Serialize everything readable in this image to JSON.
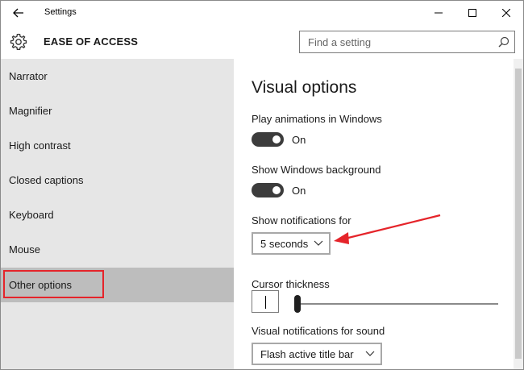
{
  "window": {
    "title": "Settings"
  },
  "header": {
    "app_title": "EASE OF ACCESS",
    "search_placeholder": "Find a setting"
  },
  "nav": {
    "items": [
      {
        "label": "Narrator"
      },
      {
        "label": "Magnifier"
      },
      {
        "label": "High contrast"
      },
      {
        "label": "Closed captions"
      },
      {
        "label": "Keyboard"
      },
      {
        "label": "Mouse"
      },
      {
        "label": "Other options"
      }
    ],
    "selected_index": 6
  },
  "content": {
    "section_title": "Visual options",
    "play_animations": {
      "label": "Play animations in Windows",
      "state": "On"
    },
    "show_background": {
      "label": "Show Windows background",
      "state": "On"
    },
    "notifications": {
      "label": "Show notifications for",
      "value": "5 seconds"
    },
    "cursor": {
      "label": "Cursor thickness",
      "value_fraction": 0.0
    },
    "sound_notifications": {
      "label": "Visual notifications for sound",
      "value": "Flash active title bar"
    }
  },
  "colors": {
    "accent_toggle": "#3c3c3c",
    "selected_nav": "#bdbdbd",
    "nav_background": "#e6e6e6",
    "annotation_red": "#e5242a"
  },
  "icons": {
    "back": "back-arrow-icon",
    "settings": "gear-icon",
    "search": "search-icon",
    "minimize": "minimize-icon",
    "maximize": "maximize-icon",
    "close": "close-icon",
    "dropdown": "chevron-down-icon"
  }
}
